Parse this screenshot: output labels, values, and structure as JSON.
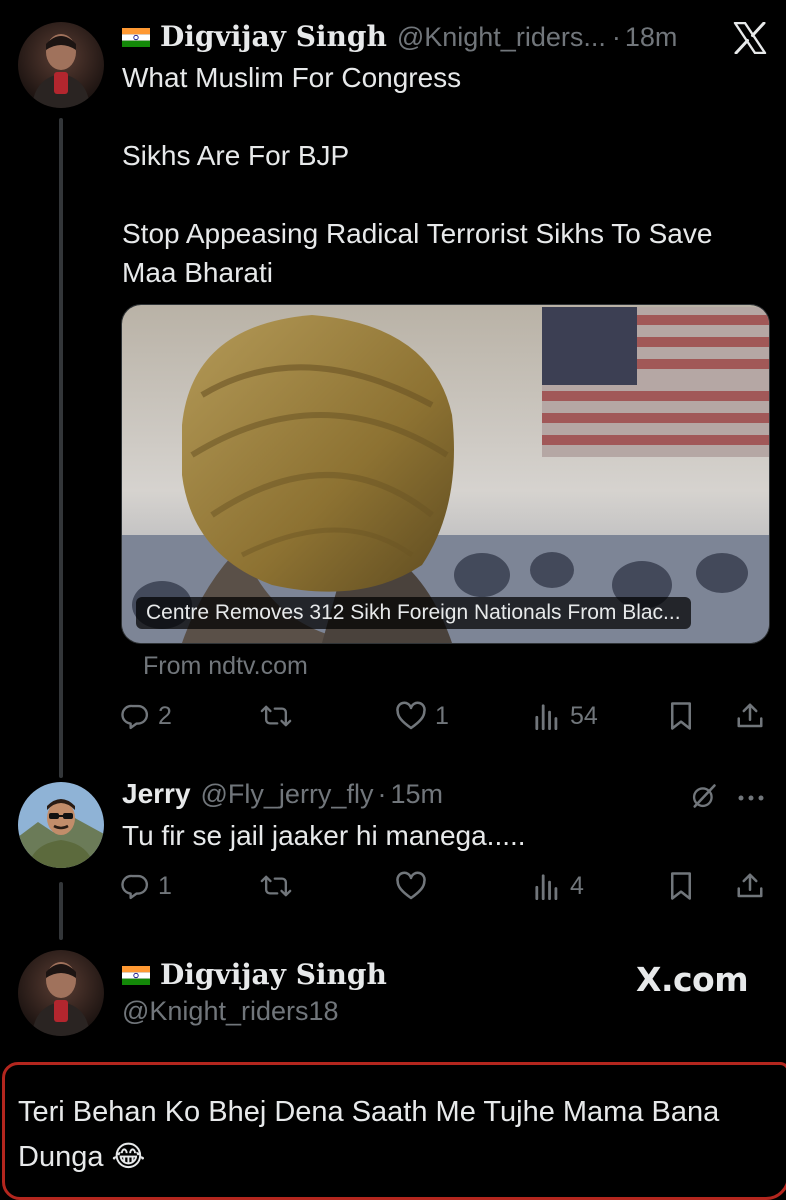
{
  "tweet1": {
    "flag": "india-flag",
    "name": "Digvijay Singh",
    "handle": "@Knight_riders...",
    "dot": "·",
    "time": "18m",
    "lines": [
      "What Muslim For Congress",
      "Sikhs Are For BJP",
      "Stop Appeasing Radical Terrorist Sikhs To Save Maa Bharati"
    ],
    "card": {
      "caption": "Centre Removes 312 Sikh Foreign Nationals From Blac...",
      "source": "From ndtv.com"
    },
    "stats": {
      "replies": "2",
      "retweets": "",
      "likes": "1",
      "views": "54"
    }
  },
  "tweet2": {
    "name": "Jerry",
    "handle": "@Fly_jerry_fly",
    "dot": "·",
    "time": "15m",
    "text": "Tu fir se jail jaaker hi manega.....",
    "stats": {
      "replies": "1",
      "retweets": "",
      "likes": "",
      "views": "4"
    }
  },
  "tweet3": {
    "name": "Digvijay Singh",
    "handle": "@Knight_riders18",
    "brand": "X.com",
    "text": "Teri Behan Ko Bhej Dena Saath Me Tujhe Mama Bana Dunga 😂"
  },
  "icons": {
    "close": "x-logo-icon",
    "reply": "reply-icon",
    "retweet": "retweet-icon",
    "like": "heart-icon",
    "views": "views-icon",
    "bookmark": "bookmark-icon",
    "share": "share-icon",
    "grok": "grok-icon",
    "more": "more-icon"
  },
  "colors": {
    "background": "#000000",
    "text": "#e7e9ea",
    "muted": "#71767b",
    "annotation": "#b3261e"
  }
}
